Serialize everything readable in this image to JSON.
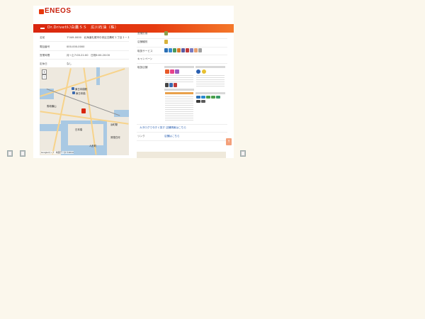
{
  "brand": {
    "logo_text": "ENEOS",
    "accent": "#e8380d"
  },
  "header": {
    "title": "Dr.Driveｾﾙﾌ白鷹ＳＳ　広川石油（株）"
  },
  "info": [
    {
      "label": "名前",
      "value": "〒049-0000　北海道札幌市中央区白鷹町１丁目１－１"
    },
    {
      "label": "電話番号",
      "value": "000-000-0000"
    },
    {
      "label": "営業時間",
      "value": "月～土7:00-21:00　日祝8:00-20:00"
    },
    {
      "label": "定休日",
      "value": "なし"
    }
  ],
  "right": {
    "labels": [
      "営業形態",
      "店舗種別",
      "取扱サービス",
      "キャンペーン",
      "取扱店舗"
    ],
    "links": [
      "カタログで今すぐ探す 店舗情報はこちら",
      "リンク",
      "店舗はこちら"
    ]
  },
  "map": {
    "labels": [
      "東日本橋駅",
      "東日本橋",
      "馬喰横山",
      "浜町駅",
      "日本橋",
      "清澄白河",
      "人形町"
    ],
    "zoom_in": "+",
    "zoom_out": "−",
    "footer": "Googleマップ　地図データ ©2014"
  },
  "to_top_icon": "arrow-up-icon"
}
